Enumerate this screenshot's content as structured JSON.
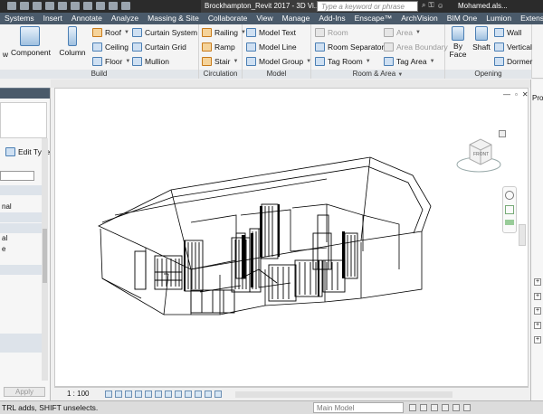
{
  "titlebar": {
    "doc_title": "Brockhampton_Revit 2017 - 3D Vi...",
    "search_placeholder": "Type a keyword or phrase",
    "user": "Mohamed.als...",
    "title_color": "#2b2b2b"
  },
  "tabs": [
    {
      "label": "Systems"
    },
    {
      "label": "Insert"
    },
    {
      "label": "Annotate"
    },
    {
      "label": "Analyze"
    },
    {
      "label": "Massing & Site"
    },
    {
      "label": "Collaborate"
    },
    {
      "label": "View"
    },
    {
      "label": "Manage"
    },
    {
      "label": "Add-Ins"
    },
    {
      "label": "Enscape™"
    },
    {
      "label": "ArchVision"
    },
    {
      "label": "BIM One"
    },
    {
      "label": "Lumion"
    },
    {
      "label": "Extensions"
    }
  ],
  "ribbon": {
    "build": {
      "title": "Build",
      "partial": "w",
      "component": "Component",
      "column": "Column",
      "roof": "Roof",
      "ceiling": "Ceiling",
      "floor": "Floor",
      "curtain_system": "Curtain System",
      "curtain_grid": "Curtain Grid",
      "mullion": "Mullion"
    },
    "circulation": {
      "title": "Circulation",
      "railing": "Railing",
      "ramp": "Ramp",
      "stair": "Stair"
    },
    "model": {
      "title": "Model",
      "model_text": "Model Text",
      "model_line": "Model Line",
      "model_group": "Model Group"
    },
    "room_area": {
      "title": "Room & Area",
      "room": "Room",
      "room_separator": "Room Separator",
      "tag_room": "Tag Room",
      "area": "Area",
      "area_boundary": "Area Boundary",
      "tag_area": "Tag Area"
    },
    "opening": {
      "title": "Opening",
      "by_face": "By Face",
      "shaft": "Shaft",
      "wall": "Wall",
      "vertical": "Vertical",
      "dormer": "Dormer"
    }
  },
  "properties": {
    "edit_type": "Edit Type",
    "rows": [
      "nal",
      "al",
      "e"
    ],
    "apply": "Apply"
  },
  "right_panel": {
    "label": "Pro"
  },
  "viewcube": {
    "face": "FRONT"
  },
  "view_control": {
    "scale": "1 : 100"
  },
  "status": {
    "message": "TRL adds, SHIFT unselects.",
    "active_model": "Main Model"
  },
  "colors": {
    "tab_bar": "#4a5a6a",
    "accent_blue": "#4b7fb4",
    "ribbon_bg": "#f4f4f4"
  }
}
